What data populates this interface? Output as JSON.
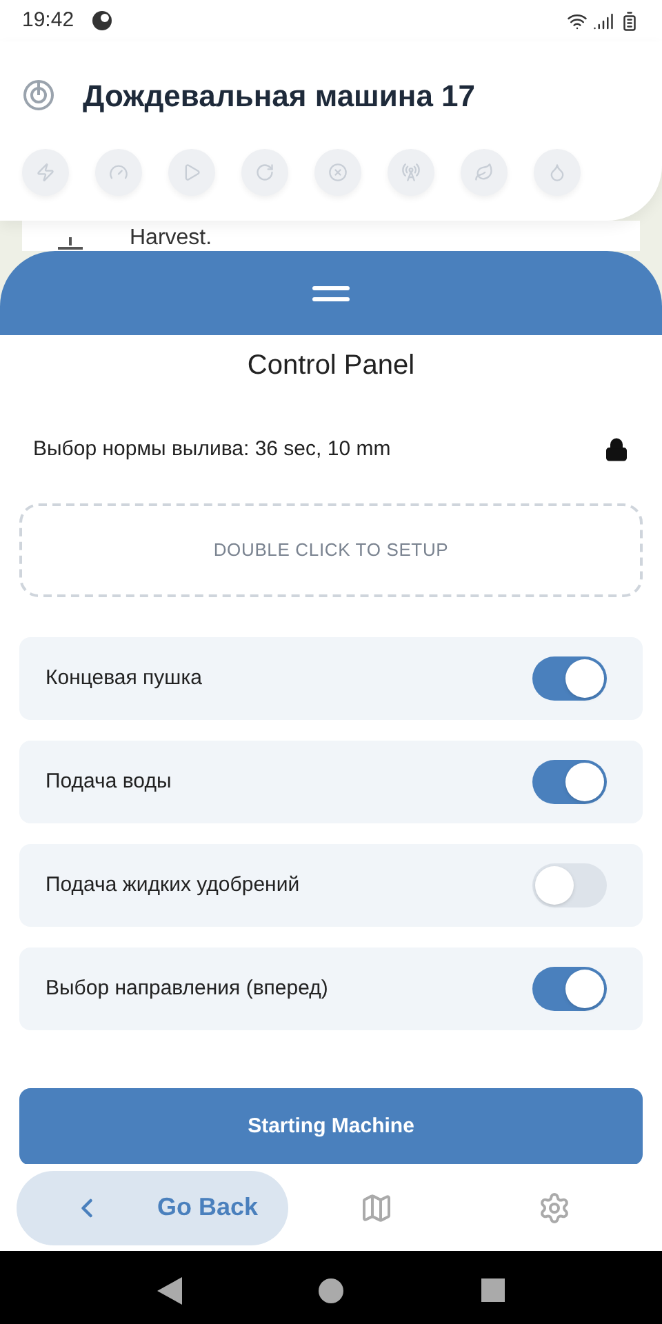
{
  "status_bar": {
    "time": "19:42"
  },
  "header": {
    "title": "Дождевальная машина 17"
  },
  "background_row": {
    "text": "Harvest."
  },
  "panel": {
    "title": "Control Panel",
    "rate_label": "Выбор нормы вылива: 36 sec, 10 mm",
    "locked": true,
    "setup_hint": "DOUBLE CLICK TO SETUP"
  },
  "toggles": [
    {
      "label": "Концевая пушка",
      "on": true
    },
    {
      "label": "Подача воды",
      "on": true
    },
    {
      "label": "Подача жидких удобрений",
      "on": false
    },
    {
      "label": "Выбор направления (вперед)",
      "on": true
    }
  ],
  "start_button": "Starting Machine",
  "bottom_nav": {
    "back_label": "Go Back"
  }
}
